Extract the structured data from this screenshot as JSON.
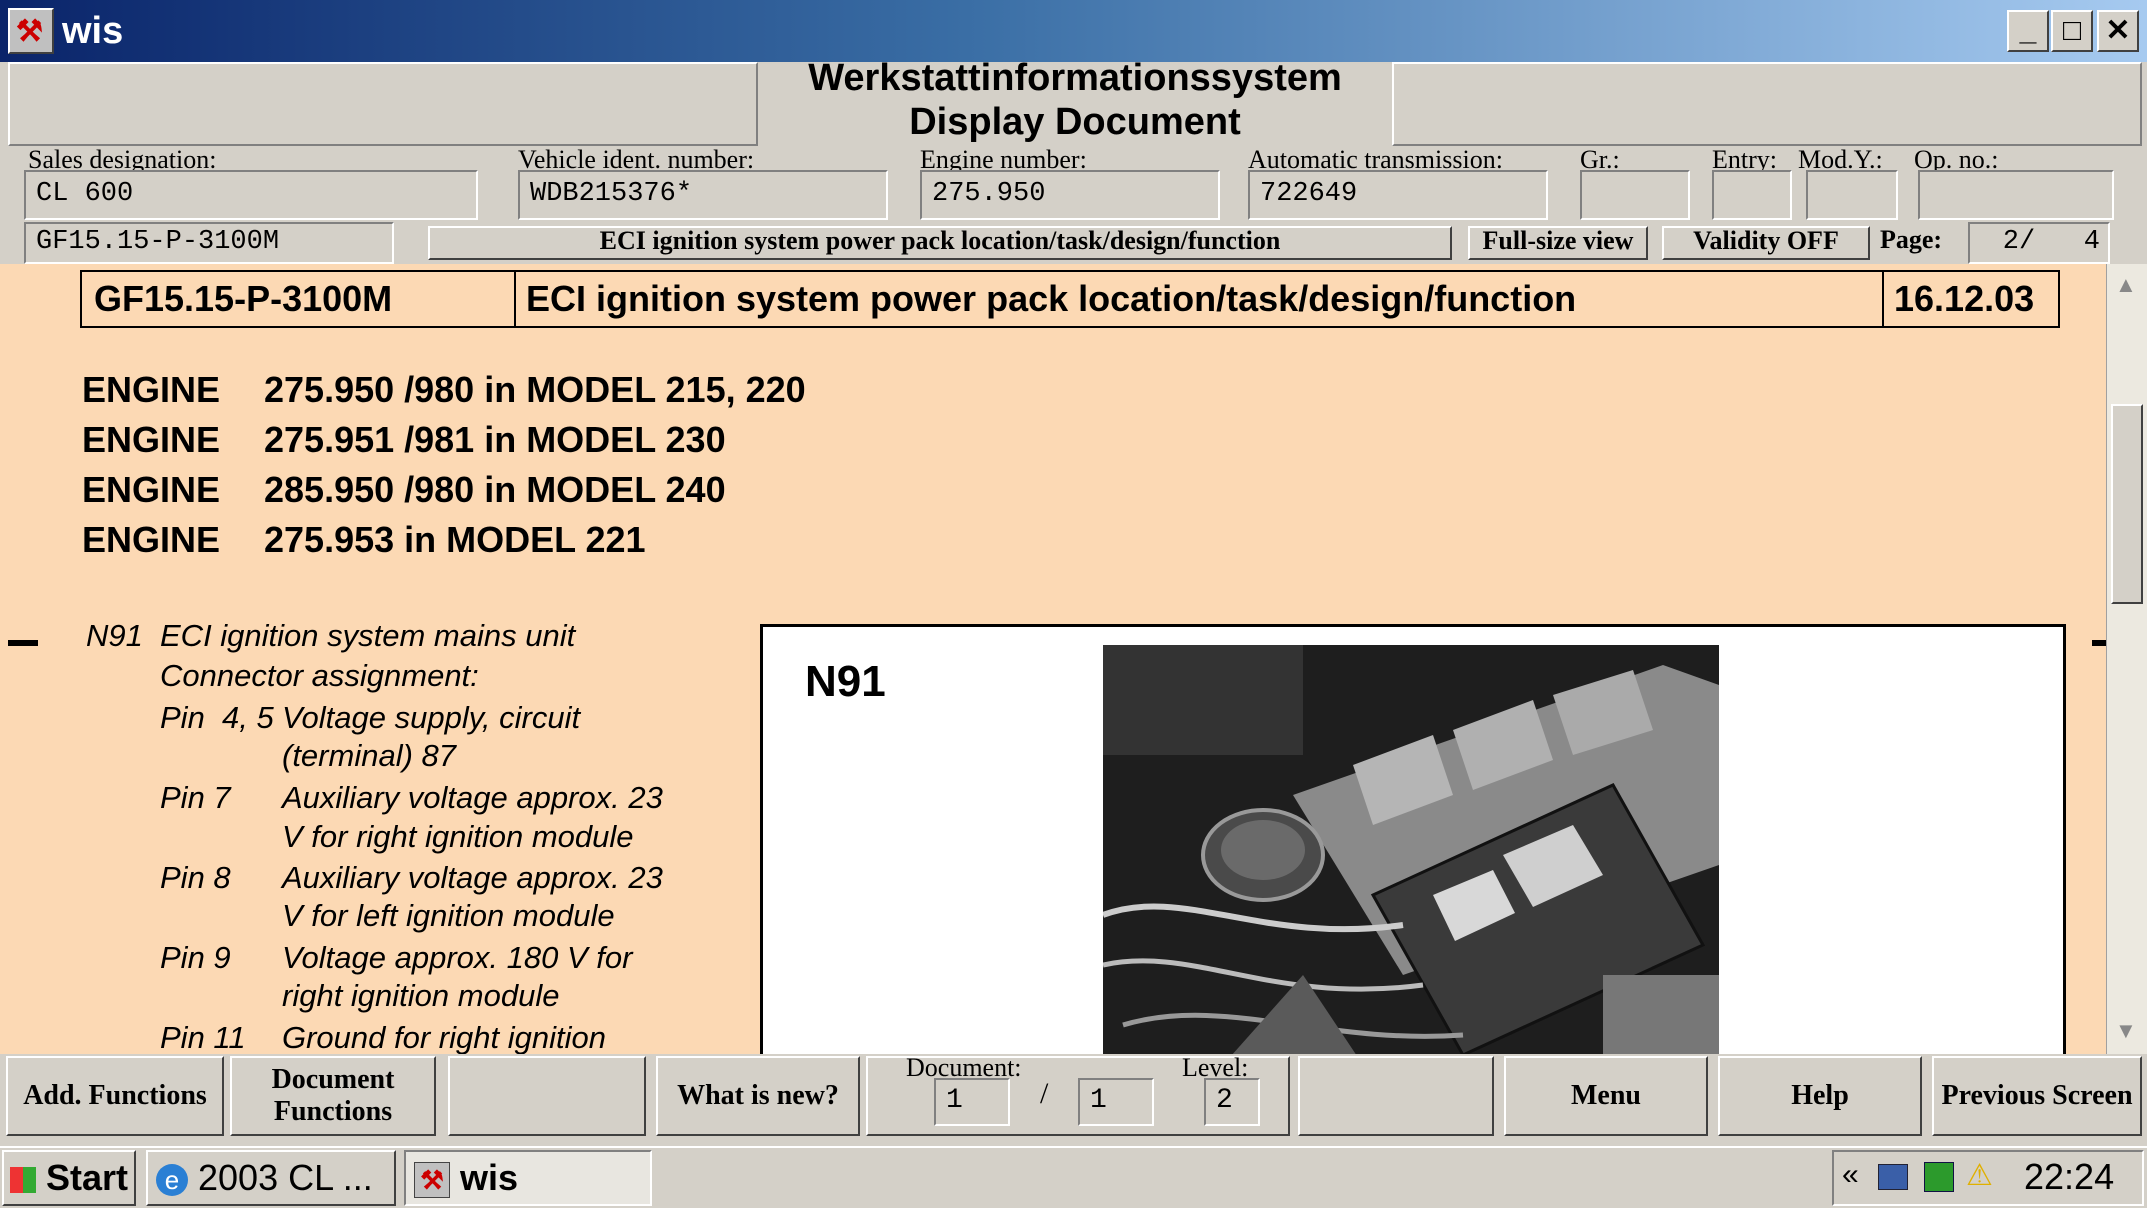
{
  "window": {
    "title": "wis"
  },
  "header": {
    "system_title_line1": "Werkstattinformationssystem",
    "system_title_line2": "Display Document",
    "fields": {
      "sales_designation": {
        "label": "Sales designation:",
        "value": "CL 600"
      },
      "vin": {
        "label": "Vehicle ident. number:",
        "value": "WDB215376*"
      },
      "engine_number": {
        "label": "Engine number:",
        "value": "275.950"
      },
      "automatic_transmission": {
        "label": "Automatic transmission:",
        "value": "722649"
      },
      "gr": {
        "label": "Gr.:",
        "value": ""
      },
      "entry": {
        "label": "Entry:",
        "value": ""
      },
      "mod_y": {
        "label": "Mod.Y.:",
        "value": ""
      },
      "op_no": {
        "label": "Op. no.:",
        "value": ""
      }
    }
  },
  "docbar": {
    "doc_id": "GF15.15-P-3100M",
    "doc_title": "ECI ignition system power pack location/task/design/function",
    "full_size_label": "Full-size view",
    "validity_label": "Validity OFF",
    "page_label": "Page:",
    "page_value": "2/   4"
  },
  "document": {
    "id": "GF15.15-P-3100M",
    "title": "ECI ignition system power pack location/task/design/function",
    "date": "16.12.03",
    "engines": [
      {
        "label": "ENGINE",
        "text": "275.950 /980 in MODEL 215, 220"
      },
      {
        "label": "ENGINE",
        "text": "275.951 /981 in MODEL 230"
      },
      {
        "label": "ENGINE",
        "text": "285.950 /980 in MODEL 240"
      },
      {
        "label": "ENGINE",
        "text": "275.953 in MODEL 221"
      }
    ],
    "component_code": "N91",
    "component_name": "ECI ignition system mains unit",
    "connector_heading": "Connector assignment:",
    "pins": [
      {
        "pin": "Pin  4, 5",
        "line1": "Voltage supply, circuit",
        "line2": "(terminal) 87"
      },
      {
        "pin": "Pin 7",
        "line1": "Auxiliary voltage approx. 23",
        "line2": "V for right ignition module"
      },
      {
        "pin": "Pin 8",
        "line1": "Auxiliary voltage approx. 23",
        "line2": "V for left ignition module"
      },
      {
        "pin": "Pin 9",
        "line1": "Voltage approx. 180 V for",
        "line2": "right ignition module"
      },
      {
        "pin": "Pin 11",
        "line1": "Ground for right ignition",
        "line2": ""
      }
    ],
    "figure_label": "N91"
  },
  "toolbar": {
    "add_functions": "Add. Functions",
    "document_functions": "Document Functions",
    "whats_new": "What is new?",
    "document_label": "Document:",
    "document_value": "1",
    "document_sep": "/",
    "document_total": "1",
    "level_label": "Level:",
    "level_value": "2",
    "menu": "Menu",
    "help": "Help",
    "previous_screen": "Previous Screen"
  },
  "taskbar": {
    "start": "Start",
    "task1": "2003 CL ...",
    "task2": "wis",
    "clock": "22:24",
    "tray_chevron": "«"
  },
  "colors": {
    "content_bg": "#fcd9b4",
    "titlebar": "#0a246a",
    "chrome": "#d4d0c8"
  }
}
